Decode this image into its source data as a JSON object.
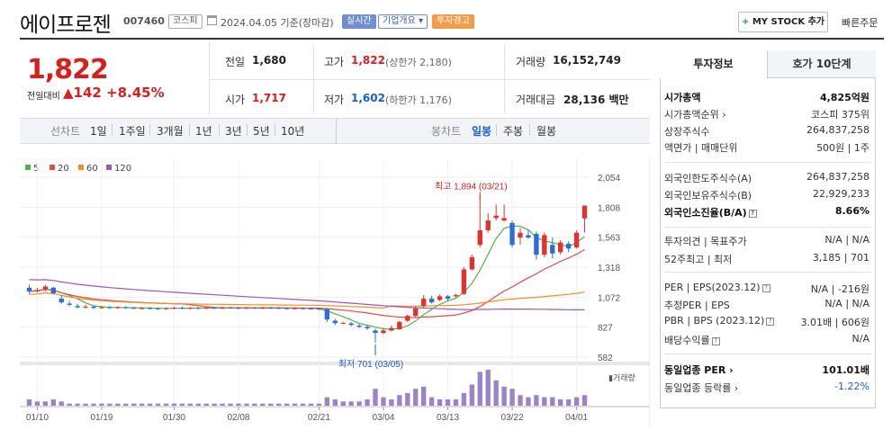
{
  "header": {
    "stock_name": "에이프로젠",
    "stock_code": "007460",
    "market_tag": "코스피",
    "date_text": "2024.04.05 기준(장마감)",
    "tag_realtime": "실시간",
    "tag_company": "기업개요 ▾",
    "tag_warning": "투자경고",
    "mystock_label": "MY STOCK 추가",
    "quick_order": "빠른주문"
  },
  "price": {
    "current": "1,822",
    "change_label": "전일대비",
    "change_arrow": "▲",
    "change_value": "142",
    "change_rate": "+8.45%"
  },
  "quote": {
    "prev_label": "전일",
    "prev_value": "1,680",
    "high_label": "고가",
    "high_value": "1,822",
    "high_sub": "(상한가 2,180)",
    "volume_label": "거래량",
    "volume_value": "16,152,749",
    "open_label": "시가",
    "open_value": "1,717",
    "low_label": "저가",
    "low_value": "1,602",
    "low_sub": "(하한가 1,176)",
    "amount_label": "거래대금",
    "amount_value": "28,136 백만"
  },
  "chart_tabs": {
    "line_chart": "선차트",
    "periods": [
      "1일",
      "1주일",
      "3개월",
      "1년",
      "3년",
      "5년",
      "10년"
    ],
    "candle_chart": "봉차트",
    "candle_periods": [
      "일봉",
      "주봉",
      "월봉"
    ],
    "selected_candle": "일봉"
  },
  "right_panel": {
    "tab_info": "투자정보",
    "tab_orderbook": "호가 10단계",
    "rows": [
      {
        "label": "시가총액",
        "value": "4,825억원",
        "bold": true
      },
      {
        "label": "시가총액순위 ›",
        "value": "코스피 375위"
      },
      {
        "label": "상장주식수",
        "value": "264,837,258"
      },
      {
        "label": "액면가 | 매매단위",
        "value": "500원 | 1주"
      },
      {
        "label": "외국인한도주식수(A)",
        "value": "264,837,258"
      },
      {
        "label": "외국인보유주식수(B)",
        "value": "22,929,233"
      },
      {
        "label": "외국인소진율(B/A)",
        "value": "8.66%",
        "bold": true
      },
      {
        "label": "투자의견 | 목표주가",
        "value": "N/A | N/A"
      },
      {
        "label": "52주최고 | 최저",
        "value": "3,185 | 701"
      },
      {
        "label": "PER | EPS(2023.12)",
        "value": "N/A | -216원"
      },
      {
        "label": "추정PER | EPS",
        "value": "N/A | N/A"
      },
      {
        "label": "PBR | BPS (2023.12)",
        "value": "3.01배 | 606원"
      },
      {
        "label": "배당수익률",
        "value": "N/A"
      },
      {
        "label": "동일업종 PER ›",
        "value": "101.01배",
        "bold": true
      },
      {
        "label": "동일업종 등락률 ›",
        "value": "-1.22%"
      }
    ]
  },
  "chart_data": {
    "type": "candlestick",
    "legend": [
      {
        "name": "5",
        "color": "#52b34a"
      },
      {
        "name": "20",
        "color": "#e04a4a"
      },
      {
        "name": "60",
        "color": "#f0902a"
      },
      {
        "name": "120",
        "color": "#9b59b6"
      }
    ],
    "price_ticks": [
      "2,054",
      "1,808",
      "1,563",
      "1,318",
      "1,072",
      "827",
      "582"
    ],
    "y_range": [
      582,
      2054
    ],
    "x_ticks": [
      "01/10",
      "01/19",
      "01/30",
      "02/08",
      "02/21",
      "03/04",
      "03/13",
      "03/22",
      "04/01"
    ],
    "high_annotation": "최고 1,894 (03/21)",
    "low_annotation": "최저 701 (03/05)",
    "volume_label": "거래량",
    "candles": [
      {
        "o": 1150,
        "c": 1120,
        "h": 1175,
        "l": 1100
      },
      {
        "o": 1120,
        "c": 1130,
        "h": 1150,
        "l": 1110
      },
      {
        "o": 1135,
        "c": 1160,
        "h": 1175,
        "l": 1120
      },
      {
        "o": 1150,
        "c": 1105,
        "h": 1160,
        "l": 1095
      },
      {
        "o": 1060,
        "c": 1030,
        "h": 1090,
        "l": 1020
      },
      {
        "o": 1020,
        "c": 1010,
        "h": 1040,
        "l": 1000
      },
      {
        "o": 1000,
        "c": 990,
        "h": 1020,
        "l": 980
      },
      {
        "o": 990,
        "c": 995,
        "h": 1010,
        "l": 980
      },
      {
        "o": 995,
        "c": 985,
        "h": 1005,
        "l": 975
      },
      {
        "o": 985,
        "c": 990,
        "h": 1000,
        "l": 978
      },
      {
        "o": 990,
        "c": 985,
        "h": 1000,
        "l": 978
      },
      {
        "o": 985,
        "c": 990,
        "h": 998,
        "l": 978
      },
      {
        "o": 990,
        "c": 985,
        "h": 998,
        "l": 978
      },
      {
        "o": 985,
        "c": 980,
        "h": 995,
        "l": 975
      },
      {
        "o": 980,
        "c": 983,
        "h": 992,
        "l": 973
      },
      {
        "o": 983,
        "c": 980,
        "h": 992,
        "l": 973
      },
      {
        "o": 980,
        "c": 978,
        "h": 990,
        "l": 970
      },
      {
        "o": 978,
        "c": 982,
        "h": 990,
        "l": 970
      },
      {
        "o": 982,
        "c": 985,
        "h": 995,
        "l": 975
      },
      {
        "o": 985,
        "c": 982,
        "h": 995,
        "l": 975
      },
      {
        "o": 982,
        "c": 985,
        "h": 993,
        "l": 975
      },
      {
        "o": 985,
        "c": 983,
        "h": 993,
        "l": 975
      },
      {
        "o": 983,
        "c": 986,
        "h": 995,
        "l": 975
      },
      {
        "o": 986,
        "c": 984,
        "h": 995,
        "l": 975
      },
      {
        "o": 984,
        "c": 987,
        "h": 995,
        "l": 975
      },
      {
        "o": 987,
        "c": 985,
        "h": 995,
        "l": 977
      },
      {
        "o": 985,
        "c": 984,
        "h": 994,
        "l": 976
      },
      {
        "o": 984,
        "c": 986,
        "h": 994,
        "l": 976
      },
      {
        "o": 986,
        "c": 984,
        "h": 993,
        "l": 976
      },
      {
        "o": 984,
        "c": 986,
        "h": 994,
        "l": 976
      },
      {
        "o": 986,
        "c": 985,
        "h": 994,
        "l": 977
      },
      {
        "o": 985,
        "c": 983,
        "h": 993,
        "l": 975
      },
      {
        "o": 983,
        "c": 980,
        "h": 990,
        "l": 972
      },
      {
        "o": 980,
        "c": 982,
        "h": 990,
        "l": 972
      },
      {
        "o": 982,
        "c": 980,
        "h": 990,
        "l": 972
      },
      {
        "o": 980,
        "c": 978,
        "h": 988,
        "l": 970
      },
      {
        "o": 978,
        "c": 975,
        "h": 985,
        "l": 968
      },
      {
        "o": 975,
        "c": 890,
        "h": 980,
        "l": 870
      },
      {
        "o": 880,
        "c": 860,
        "h": 895,
        "l": 845
      },
      {
        "o": 860,
        "c": 862,
        "h": 872,
        "l": 850
      },
      {
        "o": 858,
        "c": 845,
        "h": 868,
        "l": 835
      },
      {
        "o": 840,
        "c": 830,
        "h": 852,
        "l": 820
      },
      {
        "o": 830,
        "c": 818,
        "h": 840,
        "l": 805
      },
      {
        "o": 800,
        "c": 780,
        "h": 815,
        "l": 701
      },
      {
        "o": 780,
        "c": 800,
        "h": 820,
        "l": 770
      },
      {
        "o": 800,
        "c": 820,
        "h": 840,
        "l": 790
      },
      {
        "o": 810,
        "c": 870,
        "h": 880,
        "l": 805
      },
      {
        "o": 880,
        "c": 920,
        "h": 930,
        "l": 870
      },
      {
        "o": 920,
        "c": 980,
        "h": 1000,
        "l": 910
      },
      {
        "o": 1000,
        "c": 1060,
        "h": 1090,
        "l": 990
      },
      {
        "o": 1060,
        "c": 1030,
        "h": 1085,
        "l": 1020
      },
      {
        "o": 1050,
        "c": 1080,
        "h": 1095,
        "l": 1040
      },
      {
        "o": 1080,
        "c": 1060,
        "h": 1090,
        "l": 1040
      },
      {
        "o": 1080,
        "c": 1090,
        "h": 1100,
        "l": 1070
      },
      {
        "o": 1100,
        "c": 1300,
        "h": 1320,
        "l": 1090
      },
      {
        "o": 1300,
        "c": 1400,
        "h": 1420,
        "l": 1290
      },
      {
        "o": 1500,
        "c": 1620,
        "h": 1894,
        "l": 1480
      },
      {
        "o": 1620,
        "c": 1700,
        "h": 1760,
        "l": 1600
      },
      {
        "o": 1720,
        "c": 1740,
        "h": 1830,
        "l": 1700
      },
      {
        "o": 1700,
        "c": 1720,
        "h": 1830,
        "l": 1690
      },
      {
        "o": 1680,
        "c": 1500,
        "h": 1700,
        "l": 1480
      },
      {
        "o": 1560,
        "c": 1600,
        "h": 1640,
        "l": 1500
      },
      {
        "o": 1580,
        "c": 1560,
        "h": 1620,
        "l": 1550
      },
      {
        "o": 1590,
        "c": 1420,
        "h": 1610,
        "l": 1380
      },
      {
        "o": 1420,
        "c": 1580,
        "h": 1600,
        "l": 1400
      },
      {
        "o": 1500,
        "c": 1430,
        "h": 1560,
        "l": 1390
      },
      {
        "o": 1440,
        "c": 1520,
        "h": 1540,
        "l": 1420
      },
      {
        "o": 1510,
        "c": 1470,
        "h": 1530,
        "l": 1440
      },
      {
        "o": 1480,
        "c": 1600,
        "h": 1620,
        "l": 1470
      },
      {
        "o": 1717,
        "c": 1822,
        "h": 1822,
        "l": 1602
      }
    ],
    "volumes": [
      3,
      2,
      2,
      3,
      2,
      1,
      1,
      1,
      1,
      1,
      1,
      1,
      1,
      1,
      1,
      1,
      1,
      1,
      1,
      1,
      1,
      1,
      1,
      1,
      1,
      1,
      1,
      1,
      1,
      1,
      1,
      1,
      1,
      1,
      1,
      1,
      1,
      4,
      3,
      2,
      2,
      2,
      3,
      8,
      4,
      3,
      5,
      6,
      8,
      9,
      4,
      3,
      3,
      3,
      6,
      10,
      16,
      17,
      12,
      9,
      8,
      5,
      4,
      5,
      4,
      4,
      3,
      3,
      4,
      5
    ]
  }
}
